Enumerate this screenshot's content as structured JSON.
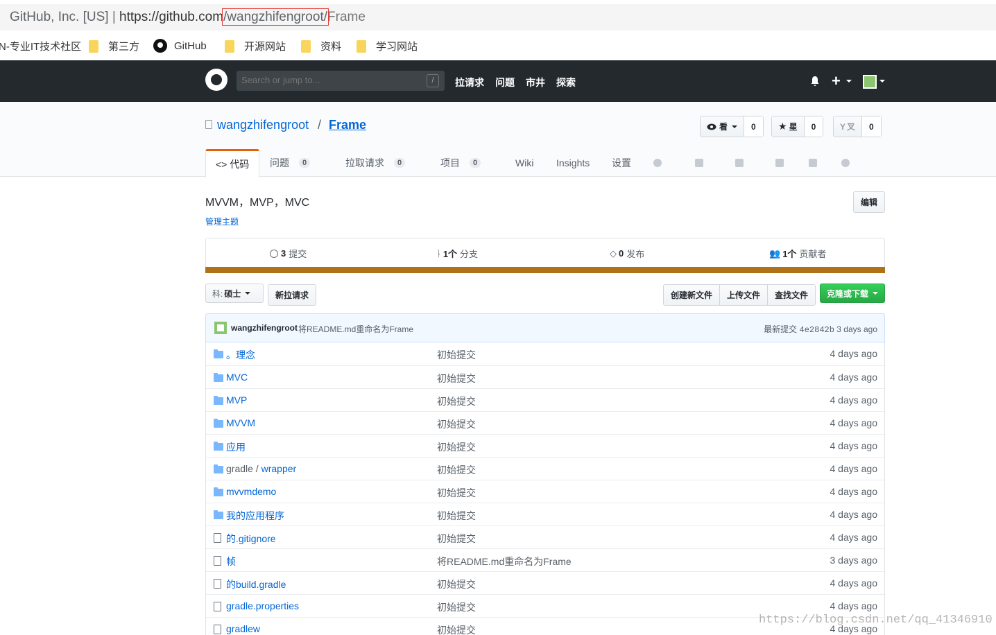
{
  "browser": {
    "org": "GitHub, Inc. [US]",
    "sep": "|",
    "host": "https://github.com",
    "path_highlight": "/wangzhifengroot/",
    "path_rest": "Frame"
  },
  "bookmarks": [
    {
      "label": "N-专业IT技术社区",
      "icon": "none"
    },
    {
      "label": "第三方",
      "icon": "folder-icon"
    },
    {
      "label": "GitHub",
      "icon": "github-icon"
    },
    {
      "label": "开源网站",
      "icon": "folder-icon"
    },
    {
      "label": "资料",
      "icon": "folder-icon"
    },
    {
      "label": "学习网站",
      "icon": "folder-icon"
    }
  ],
  "header": {
    "search_placeholder": "Search or jump to...",
    "search_key": "/",
    "nav": [
      "拉请求",
      "问题",
      "市井",
      "探索"
    ],
    "plus": "+"
  },
  "repo": {
    "owner": "wangzhifengroot",
    "sep": "/",
    "name": "Frame",
    "watch_label": "看",
    "watch_count": "0",
    "star_label": "星",
    "star_count": "0",
    "fork_label": "叉",
    "fork_count": "0"
  },
  "tabs": [
    {
      "label": "<> 代码",
      "count": ""
    },
    {
      "label": "问题",
      "count": "0"
    },
    {
      "label": "拉取请求",
      "count": "0"
    },
    {
      "label": "项目",
      "count": "0"
    },
    {
      "label": "Wiki",
      "count": ""
    },
    {
      "label": "Insights",
      "count": ""
    },
    {
      "label": "设置",
      "count": ""
    }
  ],
  "description": "MVVM，MVP，MVC",
  "topics_link": "管理主题",
  "edit_label": "编辑",
  "summary": {
    "commits_num": "3",
    "commits_label": "提交",
    "branches_num": "1个",
    "branches_label": "分支",
    "releases_num": "0",
    "releases_label": "发布",
    "contributors_num": "1个",
    "contributors_label": "贡献者"
  },
  "lang_color": "#b07219",
  "toolbar": {
    "branch_label": "科:",
    "branch_value": "硕士",
    "new_pr": "新拉请求",
    "create_file": "创建新文件",
    "upload": "上传文件",
    "find": "查找文件",
    "clone": "克隆或下载"
  },
  "latest_commit": {
    "author": "wangzhifengroot",
    "message": "将README.md重命名为Frame",
    "label": "最新提交",
    "sha": "4e2842b",
    "age": "3 days ago"
  },
  "files": [
    {
      "type": "dir",
      "prefix": "",
      "name": "。理念",
      "msg": "初始提交",
      "age": "4 days ago"
    },
    {
      "type": "dir",
      "prefix": "",
      "name": "MVC",
      "msg": "初始提交",
      "age": "4 days ago"
    },
    {
      "type": "dir",
      "prefix": "",
      "name": "MVP",
      "msg": "初始提交",
      "age": "4 days ago"
    },
    {
      "type": "dir",
      "prefix": "",
      "name": "MVVM",
      "msg": "初始提交",
      "age": "4 days ago"
    },
    {
      "type": "dir",
      "prefix": "",
      "name": "应用",
      "msg": "初始提交",
      "age": "4 days ago"
    },
    {
      "type": "dir",
      "prefix": "gradle / ",
      "name": "wrapper",
      "msg": "初始提交",
      "age": "4 days ago"
    },
    {
      "type": "dir",
      "prefix": "",
      "name": "mvvmdemo",
      "msg": "初始提交",
      "age": "4 days ago"
    },
    {
      "type": "dir",
      "prefix": "",
      "name": "我的应用程序",
      "msg": "初始提交",
      "age": "4 days ago"
    },
    {
      "type": "file",
      "prefix": "",
      "name": "的.gitignore",
      "msg": "初始提交",
      "age": "4 days ago"
    },
    {
      "type": "file",
      "prefix": "",
      "name": "帧",
      "msg": "将README.md重命名为Frame",
      "age": "3 days ago"
    },
    {
      "type": "file",
      "prefix": "",
      "name": "的build.gradle",
      "msg": "初始提交",
      "age": "4 days ago"
    },
    {
      "type": "file",
      "prefix": "",
      "name": "gradle.properties",
      "msg": "初始提交",
      "age": "4 days ago"
    },
    {
      "type": "file",
      "prefix": "",
      "name": "gradlew",
      "msg": "初始提交",
      "age": "4 days ago"
    }
  ],
  "watermark": "https://blog.csdn.net/qq_41346910"
}
